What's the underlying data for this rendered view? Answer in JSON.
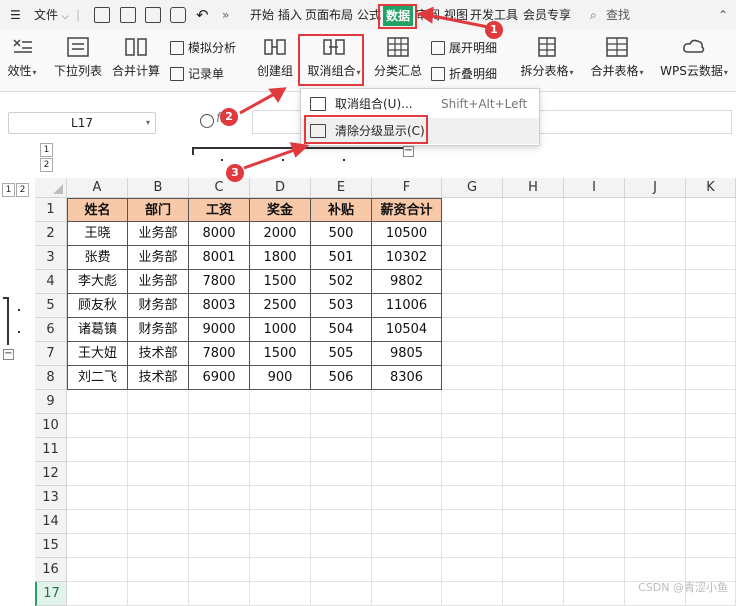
{
  "menubar": {
    "file_label": "文件",
    "tabs": [
      "开始",
      "插入",
      "页面布局",
      "公式",
      "数据",
      "审阅",
      "视图",
      "开发工具",
      "会员专享"
    ],
    "active_tab": "数据",
    "search_label": "查找"
  },
  "ribbon": {
    "cut_partial": "效性",
    "dropdown_list": "下拉列表",
    "merge_calc": "合并计算",
    "simulate": "模拟分析",
    "record": "记录单",
    "create_group": "创建组",
    "ungroup": "取消组合",
    "subtotal": "分类汇总",
    "expand_detail": "展开明细",
    "collapse_detail": "折叠明细",
    "split_table": "拆分表格",
    "merge_table": "合并表格",
    "wps_cloud": "WPS云数据"
  },
  "formula_bar": {
    "namebox_value": "L17",
    "fx_label": "fx"
  },
  "dropdown": {
    "item1_label": "取消组合(U)...",
    "item1_shortcut": "Shift+Alt+Left",
    "item2_label": "清除分级显示(C)"
  },
  "outline": {
    "levels": [
      "1",
      "2"
    ]
  },
  "grid": {
    "columns": [
      "A",
      "B",
      "C",
      "D",
      "E",
      "F",
      "G",
      "H",
      "I",
      "J",
      "K"
    ],
    "row_numbers": [
      "1",
      "2",
      "3",
      "4",
      "5",
      "6",
      "7",
      "8",
      "9",
      "10",
      "11",
      "12",
      "13",
      "14",
      "15",
      "16",
      "17"
    ],
    "header_row": [
      "姓名",
      "部门",
      "工资",
      "奖金",
      "补贴",
      "薪资合计"
    ],
    "rows": [
      [
        "王晓",
        "业务部",
        "8000",
        "2000",
        "500",
        "10500"
      ],
      [
        "张费",
        "业务部",
        "8001",
        "1800",
        "501",
        "10302"
      ],
      [
        "李大彪",
        "业务部",
        "7800",
        "1500",
        "502",
        "9802"
      ],
      [
        "顾友秋",
        "财务部",
        "8003",
        "2500",
        "503",
        "11006"
      ],
      [
        "诸葛镇",
        "财务部",
        "9000",
        "1000",
        "504",
        "10504"
      ],
      [
        "王大妞",
        "技术部",
        "7800",
        "1500",
        "505",
        "9805"
      ],
      [
        "刘二飞",
        "技术部",
        "6900",
        "900",
        "506",
        "8306"
      ]
    ]
  },
  "annotations": {
    "badges": [
      "1",
      "2",
      "3"
    ]
  },
  "colors": {
    "accent": "#21a366",
    "annotation": "#e0393e",
    "header_fill": "#f7c9a8"
  },
  "watermark": "CSDN @青涩小鱼"
}
